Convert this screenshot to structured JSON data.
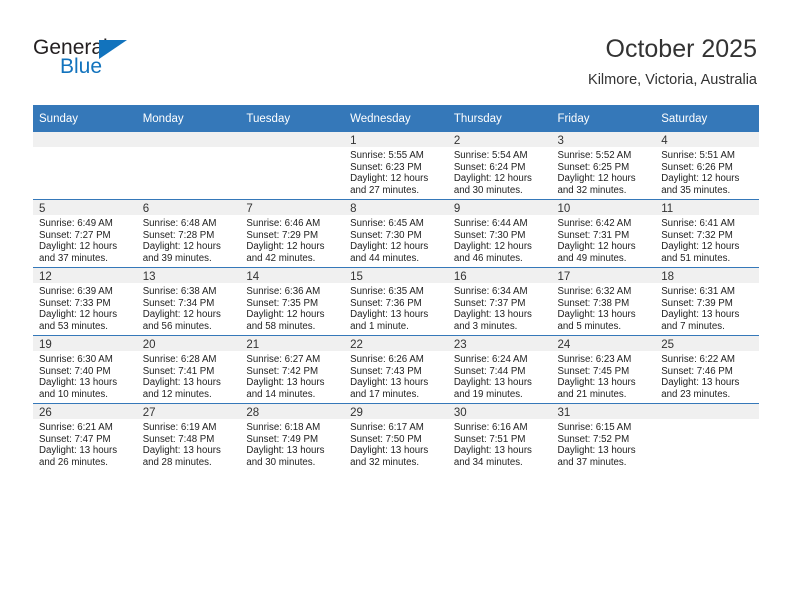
{
  "brand": {
    "name_part1": "General",
    "name_part2": "Blue",
    "accent_color": "#1273bd"
  },
  "header": {
    "title": "October 2025",
    "subtitle": "Kilmore, Victoria, Australia"
  },
  "theme": {
    "header_row_bg": "#3578b9",
    "daynum_band_bg": "#f0f0f0",
    "grid_line": "#3578b9"
  },
  "calendar": {
    "weekday_headers": [
      "Sunday",
      "Monday",
      "Tuesday",
      "Wednesday",
      "Thursday",
      "Friday",
      "Saturday"
    ],
    "weeks": [
      [
        {
          "day": "",
          "blank": true,
          "sunrise": "",
          "sunset": "",
          "daylight_1": "",
          "daylight_2": ""
        },
        {
          "day": "",
          "blank": true,
          "sunrise": "",
          "sunset": "",
          "daylight_1": "",
          "daylight_2": ""
        },
        {
          "day": "",
          "blank": true,
          "sunrise": "",
          "sunset": "",
          "daylight_1": "",
          "daylight_2": ""
        },
        {
          "day": "1",
          "blank": false,
          "sunrise": "Sunrise: 5:55 AM",
          "sunset": "Sunset: 6:23 PM",
          "daylight_1": "Daylight: 12 hours",
          "daylight_2": "and 27 minutes."
        },
        {
          "day": "2",
          "blank": false,
          "sunrise": "Sunrise: 5:54 AM",
          "sunset": "Sunset: 6:24 PM",
          "daylight_1": "Daylight: 12 hours",
          "daylight_2": "and 30 minutes."
        },
        {
          "day": "3",
          "blank": false,
          "sunrise": "Sunrise: 5:52 AM",
          "sunset": "Sunset: 6:25 PM",
          "daylight_1": "Daylight: 12 hours",
          "daylight_2": "and 32 minutes."
        },
        {
          "day": "4",
          "blank": false,
          "sunrise": "Sunrise: 5:51 AM",
          "sunset": "Sunset: 6:26 PM",
          "daylight_1": "Daylight: 12 hours",
          "daylight_2": "and 35 minutes."
        }
      ],
      [
        {
          "day": "5",
          "blank": false,
          "sunrise": "Sunrise: 6:49 AM",
          "sunset": "Sunset: 7:27 PM",
          "daylight_1": "Daylight: 12 hours",
          "daylight_2": "and 37 minutes."
        },
        {
          "day": "6",
          "blank": false,
          "sunrise": "Sunrise: 6:48 AM",
          "sunset": "Sunset: 7:28 PM",
          "daylight_1": "Daylight: 12 hours",
          "daylight_2": "and 39 minutes."
        },
        {
          "day": "7",
          "blank": false,
          "sunrise": "Sunrise: 6:46 AM",
          "sunset": "Sunset: 7:29 PM",
          "daylight_1": "Daylight: 12 hours",
          "daylight_2": "and 42 minutes."
        },
        {
          "day": "8",
          "blank": false,
          "sunrise": "Sunrise: 6:45 AM",
          "sunset": "Sunset: 7:30 PM",
          "daylight_1": "Daylight: 12 hours",
          "daylight_2": "and 44 minutes."
        },
        {
          "day": "9",
          "blank": false,
          "sunrise": "Sunrise: 6:44 AM",
          "sunset": "Sunset: 7:30 PM",
          "daylight_1": "Daylight: 12 hours",
          "daylight_2": "and 46 minutes."
        },
        {
          "day": "10",
          "blank": false,
          "sunrise": "Sunrise: 6:42 AM",
          "sunset": "Sunset: 7:31 PM",
          "daylight_1": "Daylight: 12 hours",
          "daylight_2": "and 49 minutes."
        },
        {
          "day": "11",
          "blank": false,
          "sunrise": "Sunrise: 6:41 AM",
          "sunset": "Sunset: 7:32 PM",
          "daylight_1": "Daylight: 12 hours",
          "daylight_2": "and 51 minutes."
        }
      ],
      [
        {
          "day": "12",
          "blank": false,
          "sunrise": "Sunrise: 6:39 AM",
          "sunset": "Sunset: 7:33 PM",
          "daylight_1": "Daylight: 12 hours",
          "daylight_2": "and 53 minutes."
        },
        {
          "day": "13",
          "blank": false,
          "sunrise": "Sunrise: 6:38 AM",
          "sunset": "Sunset: 7:34 PM",
          "daylight_1": "Daylight: 12 hours",
          "daylight_2": "and 56 minutes."
        },
        {
          "day": "14",
          "blank": false,
          "sunrise": "Sunrise: 6:36 AM",
          "sunset": "Sunset: 7:35 PM",
          "daylight_1": "Daylight: 12 hours",
          "daylight_2": "and 58 minutes."
        },
        {
          "day": "15",
          "blank": false,
          "sunrise": "Sunrise: 6:35 AM",
          "sunset": "Sunset: 7:36 PM",
          "daylight_1": "Daylight: 13 hours",
          "daylight_2": "and 1 minute."
        },
        {
          "day": "16",
          "blank": false,
          "sunrise": "Sunrise: 6:34 AM",
          "sunset": "Sunset: 7:37 PM",
          "daylight_1": "Daylight: 13 hours",
          "daylight_2": "and 3 minutes."
        },
        {
          "day": "17",
          "blank": false,
          "sunrise": "Sunrise: 6:32 AM",
          "sunset": "Sunset: 7:38 PM",
          "daylight_1": "Daylight: 13 hours",
          "daylight_2": "and 5 minutes."
        },
        {
          "day": "18",
          "blank": false,
          "sunrise": "Sunrise: 6:31 AM",
          "sunset": "Sunset: 7:39 PM",
          "daylight_1": "Daylight: 13 hours",
          "daylight_2": "and 7 minutes."
        }
      ],
      [
        {
          "day": "19",
          "blank": false,
          "sunrise": "Sunrise: 6:30 AM",
          "sunset": "Sunset: 7:40 PM",
          "daylight_1": "Daylight: 13 hours",
          "daylight_2": "and 10 minutes."
        },
        {
          "day": "20",
          "blank": false,
          "sunrise": "Sunrise: 6:28 AM",
          "sunset": "Sunset: 7:41 PM",
          "daylight_1": "Daylight: 13 hours",
          "daylight_2": "and 12 minutes."
        },
        {
          "day": "21",
          "blank": false,
          "sunrise": "Sunrise: 6:27 AM",
          "sunset": "Sunset: 7:42 PM",
          "daylight_1": "Daylight: 13 hours",
          "daylight_2": "and 14 minutes."
        },
        {
          "day": "22",
          "blank": false,
          "sunrise": "Sunrise: 6:26 AM",
          "sunset": "Sunset: 7:43 PM",
          "daylight_1": "Daylight: 13 hours",
          "daylight_2": "and 17 minutes."
        },
        {
          "day": "23",
          "blank": false,
          "sunrise": "Sunrise: 6:24 AM",
          "sunset": "Sunset: 7:44 PM",
          "daylight_1": "Daylight: 13 hours",
          "daylight_2": "and 19 minutes."
        },
        {
          "day": "24",
          "blank": false,
          "sunrise": "Sunrise: 6:23 AM",
          "sunset": "Sunset: 7:45 PM",
          "daylight_1": "Daylight: 13 hours",
          "daylight_2": "and 21 minutes."
        },
        {
          "day": "25",
          "blank": false,
          "sunrise": "Sunrise: 6:22 AM",
          "sunset": "Sunset: 7:46 PM",
          "daylight_1": "Daylight: 13 hours",
          "daylight_2": "and 23 minutes."
        }
      ],
      [
        {
          "day": "26",
          "blank": false,
          "sunrise": "Sunrise: 6:21 AM",
          "sunset": "Sunset: 7:47 PM",
          "daylight_1": "Daylight: 13 hours",
          "daylight_2": "and 26 minutes."
        },
        {
          "day": "27",
          "blank": false,
          "sunrise": "Sunrise: 6:19 AM",
          "sunset": "Sunset: 7:48 PM",
          "daylight_1": "Daylight: 13 hours",
          "daylight_2": "and 28 minutes."
        },
        {
          "day": "28",
          "blank": false,
          "sunrise": "Sunrise: 6:18 AM",
          "sunset": "Sunset: 7:49 PM",
          "daylight_1": "Daylight: 13 hours",
          "daylight_2": "and 30 minutes."
        },
        {
          "day": "29",
          "blank": false,
          "sunrise": "Sunrise: 6:17 AM",
          "sunset": "Sunset: 7:50 PM",
          "daylight_1": "Daylight: 13 hours",
          "daylight_2": "and 32 minutes."
        },
        {
          "day": "30",
          "blank": false,
          "sunrise": "Sunrise: 6:16 AM",
          "sunset": "Sunset: 7:51 PM",
          "daylight_1": "Daylight: 13 hours",
          "daylight_2": "and 34 minutes."
        },
        {
          "day": "31",
          "blank": false,
          "sunrise": "Sunrise: 6:15 AM",
          "sunset": "Sunset: 7:52 PM",
          "daylight_1": "Daylight: 13 hours",
          "daylight_2": "and 37 minutes."
        },
        {
          "day": "",
          "blank": true,
          "sunrise": "",
          "sunset": "",
          "daylight_1": "",
          "daylight_2": ""
        }
      ]
    ]
  }
}
